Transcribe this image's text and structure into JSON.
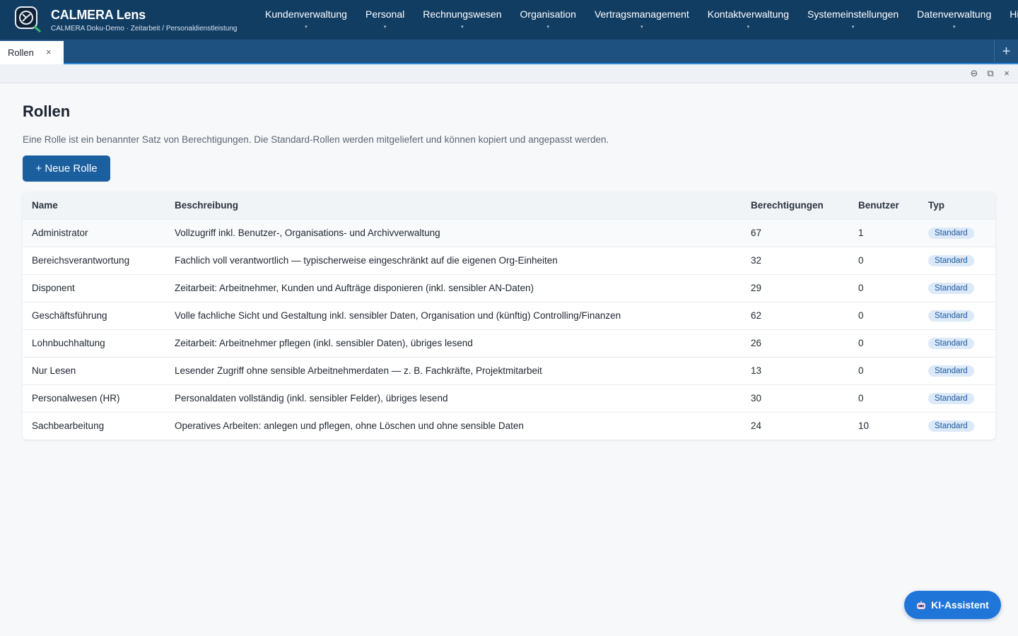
{
  "app": {
    "title": "CALMERA Lens",
    "subtitle": "CALMERA Doku-Demo · Zeitarbeit / Personaldienstleistung"
  },
  "nav": {
    "items": [
      {
        "label": "Kundenverwaltung"
      },
      {
        "label": "Personal"
      },
      {
        "label": "Rechnungswesen"
      },
      {
        "label": "Organisation"
      },
      {
        "label": "Vertragsmanagement"
      },
      {
        "label": "Kontaktverwaltung"
      },
      {
        "label": "Systemeinstellungen"
      },
      {
        "label": "Datenverwaltung"
      },
      {
        "label": "Hilfebe"
      }
    ],
    "caret": "▾"
  },
  "tabs": {
    "active_label": "Rollen",
    "close_glyph": "×",
    "add_glyph": "+"
  },
  "window_controls": {
    "minimize_glyph": "⊖",
    "restore_glyph": "⧉",
    "close_glyph": "×"
  },
  "page": {
    "title": "Rollen",
    "description": "Eine Rolle ist ein benannter Satz von Berechtigungen. Die Standard-Rollen werden mitgeliefert und können kopiert und angepasst werden.",
    "new_button": "+ Neue Rolle"
  },
  "table": {
    "headers": {
      "name": "Name",
      "beschreibung": "Beschreibung",
      "berechtigungen": "Berechtigungen",
      "benutzer": "Benutzer",
      "typ": "Typ"
    },
    "rows": [
      {
        "name": "Administrator",
        "beschreibung": "Vollzugriff inkl. Benutzer-, Organisations- und Archivverwaltung",
        "berechtigungen": "67",
        "benutzer": "1",
        "typ": "Standard"
      },
      {
        "name": "Bereichsverantwortung",
        "beschreibung": "Fachlich voll verantwortlich — typischerweise eingeschränkt auf die eigenen Org-Einheiten",
        "berechtigungen": "32",
        "benutzer": "0",
        "typ": "Standard"
      },
      {
        "name": "Disponent",
        "beschreibung": "Zeitarbeit: Arbeitnehmer, Kunden und Aufträge disponieren (inkl. sensibler AN-Daten)",
        "berechtigungen": "29",
        "benutzer": "0",
        "typ": "Standard"
      },
      {
        "name": "Geschäftsführung",
        "beschreibung": "Volle fachliche Sicht und Gestaltung inkl. sensibler Daten, Organisation und (künftig) Controlling/Finanzen",
        "berechtigungen": "62",
        "benutzer": "0",
        "typ": "Standard"
      },
      {
        "name": "Lohnbuchhaltung",
        "beschreibung": "Zeitarbeit: Arbeitnehmer pflegen (inkl. sensibler Daten), übriges lesend",
        "berechtigungen": "26",
        "benutzer": "0",
        "typ": "Standard"
      },
      {
        "name": "Nur Lesen",
        "beschreibung": "Lesender Zugriff ohne sensible Arbeitnehmerdaten — z. B. Fachkräfte, Projektmitarbeit",
        "berechtigungen": "13",
        "benutzer": "0",
        "typ": "Standard"
      },
      {
        "name": "Personalwesen (HR)",
        "beschreibung": "Personaldaten vollständig (inkl. sensibler Felder), übriges lesend",
        "berechtigungen": "30",
        "benutzer": "0",
        "typ": "Standard"
      },
      {
        "name": "Sachbearbeitung",
        "beschreibung": "Operatives Arbeiten: anlegen und pflegen, ohne Löschen und ohne sensible Daten",
        "berechtigungen": "24",
        "benutzer": "10",
        "typ": "Standard"
      }
    ]
  },
  "assistant": {
    "label": "KI-Assistent",
    "icon": "robot-icon"
  },
  "colors": {
    "topbar": "#123d63",
    "tabbar": "#1e5180",
    "primary_button": "#1b5f9f",
    "assistant_button": "#2075d8",
    "badge_bg": "#dce9f8",
    "badge_text": "#1c5aa0"
  }
}
